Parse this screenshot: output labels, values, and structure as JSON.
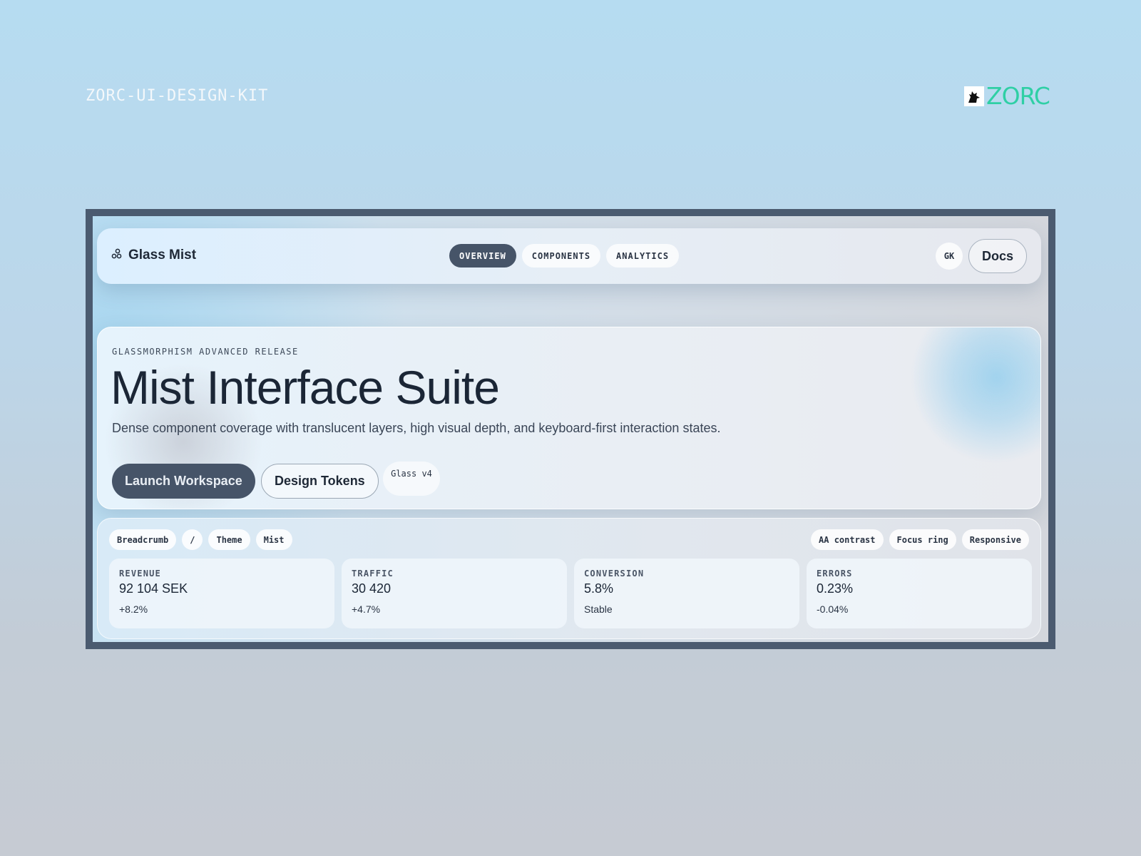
{
  "page": {
    "kit_label": "ZORC-UI-DESIGN-KIT",
    "brand": "ZORC",
    "brand_color": "#2fcfa5"
  },
  "topbar": {
    "app_name": "Glass Mist",
    "app_icon": "molecule-icon",
    "tabs": [
      {
        "label": "OVERVIEW",
        "active": true
      },
      {
        "label": "COMPONENTS",
        "active": false
      },
      {
        "label": "ANALYTICS",
        "active": false
      }
    ],
    "avatar": "GK",
    "docs_label": "Docs"
  },
  "hero": {
    "eyebrow": "GLASSMORPHISM ADVANCED RELEASE",
    "title": "Mist Interface Suite",
    "description": "Dense component coverage with translucent layers, high visual depth, and keyboard-first interaction states.",
    "primary_label": "Launch Workspace",
    "secondary_label": "Design Tokens",
    "version": "Glass v4"
  },
  "panel": {
    "breadcrumb": [
      "Breadcrumb",
      "/",
      "Theme",
      "Mist"
    ],
    "tags": [
      "AA contrast",
      "Focus ring",
      "Responsive"
    ],
    "metrics": [
      {
        "label": "REVENUE",
        "value": "92 104 SEK",
        "delta": "+8.2%"
      },
      {
        "label": "TRAFFIC",
        "value": "30 420",
        "delta": "+4.7%"
      },
      {
        "label": "CONVERSION",
        "value": "5.8%",
        "delta": "Stable"
      },
      {
        "label": "ERRORS",
        "value": "0.23%",
        "delta": "-0.04%"
      }
    ]
  },
  "colors": {
    "accent_dark": "#465468",
    "text": "#1b2636"
  }
}
